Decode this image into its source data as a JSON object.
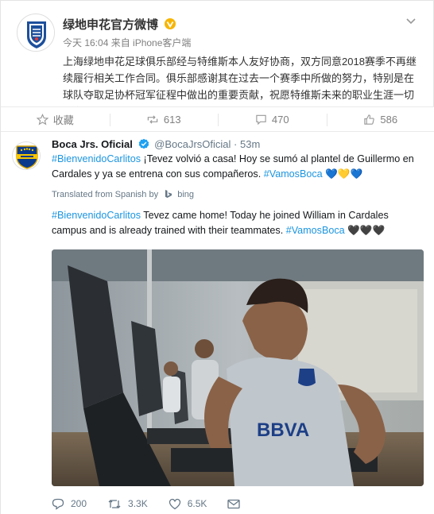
{
  "weibo": {
    "account_name": "绿地申花官方微博",
    "meta": "今天 16:04 来自 iPhone客户端",
    "post_text": "上海绿地申花足球俱乐部经与特维斯本人友好协商，双方同意2018赛季不再继续履行相关工作合同。俱乐部感谢其在过去一个赛季中所做的努力，特别是在球队夺取足协杯冠军征程中做出的重要贡献，祝愿特维斯未来的职业生涯一切顺利！",
    "actions": {
      "favorite_label": "收藏",
      "repost_count": "613",
      "comment_count": "470",
      "like_count": "586"
    },
    "colors": {
      "accent": "#e86b0f",
      "verified": "#f7b500"
    }
  },
  "tweet": {
    "display_name": "Boca Jrs. Oficial",
    "handle": "@BocaJrsOficial",
    "separator": "·",
    "time": "53m",
    "text_hashtag": "#BienvenidoCarlitos",
    "text_body": " ¡Tevez volvió a casa! Hoy se sumó al plantel de Guillermo en Cardales y ya se entrena con sus compañeros. ",
    "text_tag_end": "#VamosBoca",
    "text_emoji": " 💙💛💙",
    "translated_label": "Translated from Spanish by",
    "translator": "bing",
    "trans_hashtag": "#BienvenidoCarlitos",
    "trans_body": " Tevez came home! Today he joined William in Cardales campus and is already trained with their teammates. ",
    "trans_tag_end": "#VamosBoca",
    "trans_emoji": " 🖤🖤🖤",
    "photo_jersey_text": "BBVA",
    "reply_count": "200",
    "retweet_count": "3.3K",
    "like_count": "6.5K",
    "colors": {
      "link": "#1b95e0",
      "text": "#14171a",
      "muted": "#657786"
    }
  }
}
